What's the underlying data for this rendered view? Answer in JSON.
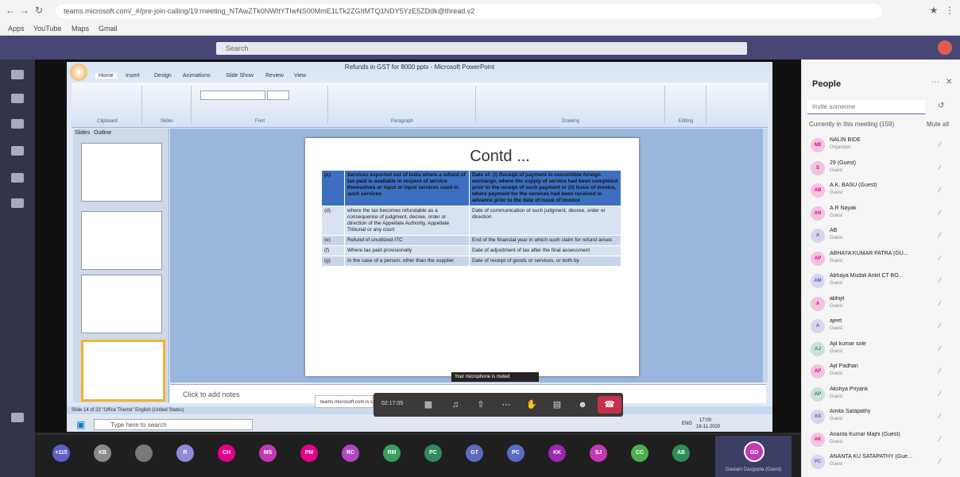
{
  "browser": {
    "url": "teams.microsoft.com/_#/pre-join-calling/19:meeting_NTAwZTk0NWItYTIwNS00MmE1LTk2ZGItMTQ1NDY5YzE5ZDdk@thread.v2",
    "bookmarks": [
      "Apps",
      "YouTube",
      "Maps",
      "Gmail"
    ]
  },
  "teams": {
    "search_placeholder": "Search"
  },
  "powerpoint": {
    "window_title": "Refunds in GST for 8000 pptx - Microsoft PowerPoint",
    "tabs": [
      "Home",
      "Insert",
      "Design",
      "Animations",
      "Slide Show",
      "Review",
      "View"
    ],
    "groups": [
      "Clipboard",
      "Slides",
      "Font",
      "Paragraph",
      "Drawing",
      "Editing"
    ],
    "pane_tabs": [
      "Slides",
      "Outline"
    ],
    "notes_placeholder": "Click to add notes",
    "status": "Slide 14 of 23    \"Office Theme\"    English (United States)",
    "slide": {
      "title": "Contd ...",
      "rows": [
        {
          "sno": "(c)",
          "case": "Services exported out of India where a refund of tax paid is available in respect of service themselves or input or input services used in such services",
          "date": "Date of: (i) Receipt of payment in convertible foreign exchange, where the supply of service had been completed prior to the receipt of such payment or (ii) Issue of invoice, where payment for the services had been received in advance prior to the date of issue of invoice",
          "highlight": true
        },
        {
          "sno": "(d)",
          "case": "where the tax becomes refundable as a consequence of judgment, decree, order or direction of the Appellate Authority, Appellate Tribunal or any court",
          "date": "Date of communication of such judgment, decree, order or direction",
          "highlight": false
        },
        {
          "sno": "(e)",
          "case": "Refund of unutilized ITC",
          "date": "End of the financial year in which such claim for refund arises",
          "highlight": false
        },
        {
          "sno": "(f)",
          "case": "Where tax paid provisionally",
          "date": "Date of adjustment of tax after the final assessment",
          "highlight": false
        },
        {
          "sno": "(g)",
          "case": "In the case of a person, other than the supplier",
          "date": "Date of receipt of goods or services, or both by",
          "highlight": false
        }
      ]
    }
  },
  "windows_taskbar": {
    "search_placeholder": "Type here to search",
    "time": "17:00",
    "date": "18-11-2020",
    "lang": "ENG"
  },
  "call": {
    "timer": "02:17:05",
    "tooltip": "Your microphone is muted",
    "notification": "teams.microsoft.com is sharing your screen."
  },
  "gallery": {
    "avatars": [
      {
        "initials": "+115",
        "color": "#5b5fc7"
      },
      {
        "initials": "KB",
        "color": "#8a8a8a"
      },
      {
        "initials": "",
        "color": "#7a7a7a"
      },
      {
        "initials": "R",
        "color": "#8e8cd8"
      },
      {
        "initials": "CH",
        "color": "#e3008c"
      },
      {
        "initials": "MS",
        "color": "#c239b3"
      },
      {
        "initials": "PM",
        "color": "#e3008c"
      },
      {
        "initials": "RC",
        "color": "#b146c2"
      },
      {
        "initials": "RM",
        "color": "#3a9f5c"
      },
      {
        "initials": "PC",
        "color": "#2e8b57"
      },
      {
        "initials": "GT",
        "color": "#5c6bc0"
      },
      {
        "initials": "PC",
        "color": "#5c6bc0"
      },
      {
        "initials": "KK",
        "color": "#9c27b0"
      },
      {
        "initials": "SJ",
        "color": "#c239b3"
      },
      {
        "initials": "CC",
        "color": "#4caf50"
      },
      {
        "initials": "AB",
        "color": "#2e8b57"
      }
    ],
    "me_initials": "GD",
    "me_label": "Gautam Dasgupta (Guest)"
  },
  "people": {
    "title": "People",
    "invite_placeholder": "Invite someone",
    "in_meeting_label": "Currently in this meeting (159)",
    "mute_all": "Mute all",
    "participants": [
      {
        "initials": "NB",
        "name": "NALIN BIDE",
        "role": "Organizer",
        "color": "#e3008c"
      },
      {
        "initials": "S",
        "name": "29 (Guest)",
        "role": "Guest",
        "color": "#e3008c"
      },
      {
        "initials": "AB",
        "name": "A.K. BASU (Guest)",
        "role": "Guest",
        "color": "#e3008c"
      },
      {
        "initials": "AN",
        "name": "A.R Nayak",
        "role": "Guest",
        "color": "#e3008c"
      },
      {
        "initials": "A",
        "name": "AB",
        "role": "Guest",
        "color": "#5b5fc7"
      },
      {
        "initials": "AP",
        "name": "ABHAYA KUMAR PATRA (GU...",
        "role": "Guest",
        "color": "#e3008c"
      },
      {
        "initials": "AM",
        "name": "Abhaya Mudali Ankit CT BO...",
        "role": "Guest",
        "color": "#5b5fc7"
      },
      {
        "initials": "A",
        "name": "abhijit",
        "role": "Guest",
        "color": "#e3008c"
      },
      {
        "initials": "A",
        "name": "ajeet",
        "role": "Guest",
        "color": "#5b5fc7"
      },
      {
        "initials": "AJ",
        "name": "Ajit kumar sole",
        "role": "Guest",
        "color": "#2e8b57"
      },
      {
        "initials": "AP",
        "name": "Ajit Padhan",
        "role": "Guest",
        "color": "#e3008c"
      },
      {
        "initials": "AP",
        "name": "Akshya Priyank",
        "role": "Guest",
        "color": "#2e8b57"
      },
      {
        "initials": "AS",
        "name": "Amita Satapathy",
        "role": "Guest",
        "color": "#5b5fc7"
      },
      {
        "initials": "AK",
        "name": "Ananta Kumar Majhi (Guest)",
        "role": "Guest",
        "color": "#e3008c"
      },
      {
        "initials": "PC",
        "name": "ANANTA KU SATAPATHY (Gue...",
        "role": "Guest",
        "color": "#5b5fc7"
      }
    ]
  }
}
